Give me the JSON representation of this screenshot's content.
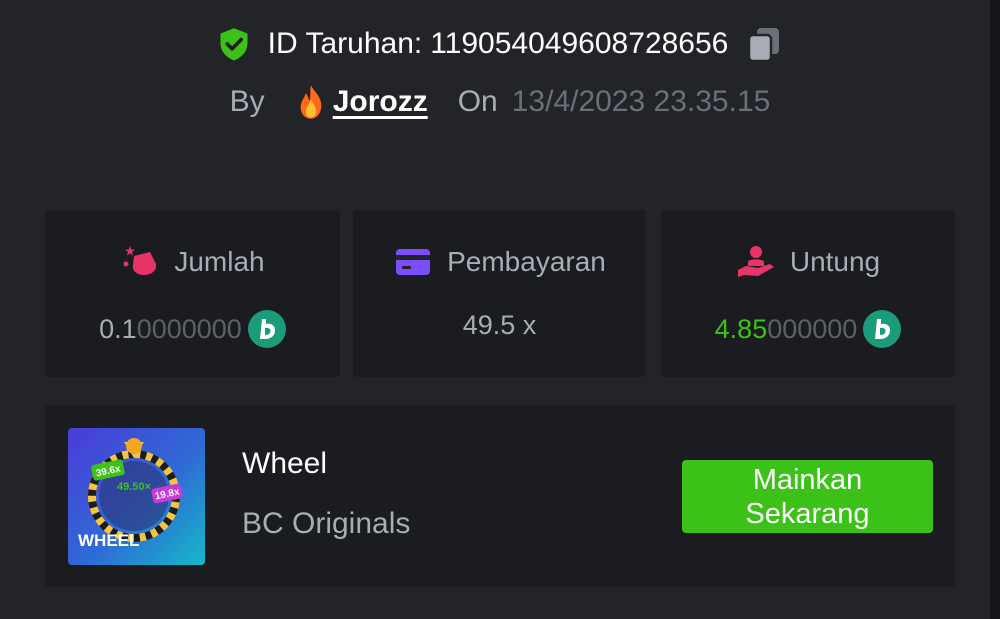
{
  "header": {
    "bet_id_label": "ID Taruhan:",
    "bet_id": "119054049608728656",
    "by_label": "By",
    "username": "Jorozz",
    "on_label": "On",
    "date": "13/4/2023 23.35.15"
  },
  "stats": {
    "amount": {
      "label": "Jumlah",
      "value_bright": "0.1",
      "value_dim": "0000000",
      "icon": "money-bag-icon"
    },
    "payout": {
      "label": "Pembayaran",
      "value": "49.5 x",
      "icon": "card-icon"
    },
    "profit": {
      "label": "Untung",
      "value_bright": "4.85",
      "value_dim": "000000",
      "icon": "hand-coin-icon"
    }
  },
  "game": {
    "title": "Wheel",
    "provider": "BC Originals",
    "play_label": "Mainkan Sekarang",
    "thumb": {
      "label": "WHEEL",
      "mult_center": "49.50×",
      "mult_left": "39.6x",
      "mult_right": "19.8x"
    }
  },
  "colors": {
    "background": "#232428",
    "card": "#1b1c1f",
    "accent_green": "#3bc117",
    "muted_text": "#a8acb7",
    "dim_text": "#5d6069",
    "coin": "#1a9c7b"
  }
}
